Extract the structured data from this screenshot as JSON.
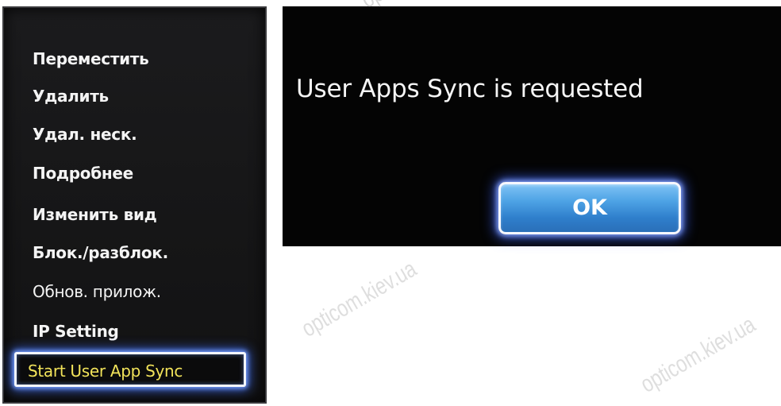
{
  "menu": {
    "items": [
      {
        "label": "Переместить"
      },
      {
        "label": "Удалить"
      },
      {
        "label": "Удал. неск."
      },
      {
        "label": "Подробнее"
      },
      {
        "label": "Изменить вид"
      },
      {
        "label": "Блок./разблок."
      },
      {
        "label": "Обнов. прилож."
      },
      {
        "label": "IP Setting"
      },
      {
        "label": "Start User App Sync"
      }
    ],
    "selected_item": "Start User App Sync"
  },
  "dialog": {
    "message": "User Apps Sync is requested",
    "ok_label": "OK"
  },
  "watermark": {
    "text": "opticom.kiev.ua"
  },
  "colors": {
    "panel_background": "#161617",
    "dialog_background": "#040404",
    "menu_text": "#f4f4f4",
    "selected_text": "#f2e35a",
    "focus_glow": "#3c6eff",
    "ok_button": "#4ea3e5"
  }
}
